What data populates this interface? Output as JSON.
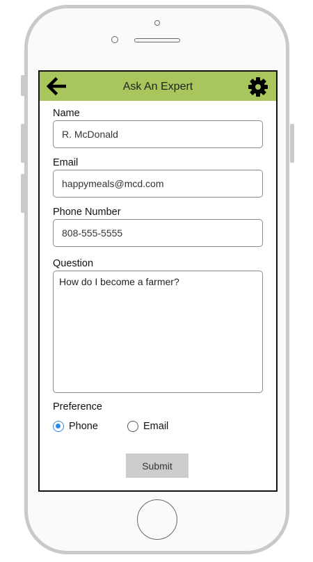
{
  "header": {
    "title": "Ask An Expert",
    "back_icon": "arrow-left-icon",
    "settings_icon": "gear-icon",
    "accent_color": "#a9c65d"
  },
  "form": {
    "name": {
      "label": "Name",
      "value": "R. McDonald"
    },
    "email": {
      "label": "Email",
      "value": "happymeals@mcd.com"
    },
    "phone": {
      "label": "Phone Number",
      "value": "808-555-5555"
    },
    "question": {
      "label": "Question",
      "value": "How do I become a farmer?"
    },
    "preference": {
      "label": "Preference",
      "options": [
        {
          "label": "Phone",
          "selected": true
        },
        {
          "label": "Email",
          "selected": false
        }
      ],
      "selected_color": "#2d86e3"
    },
    "submit_label": "Submit"
  }
}
